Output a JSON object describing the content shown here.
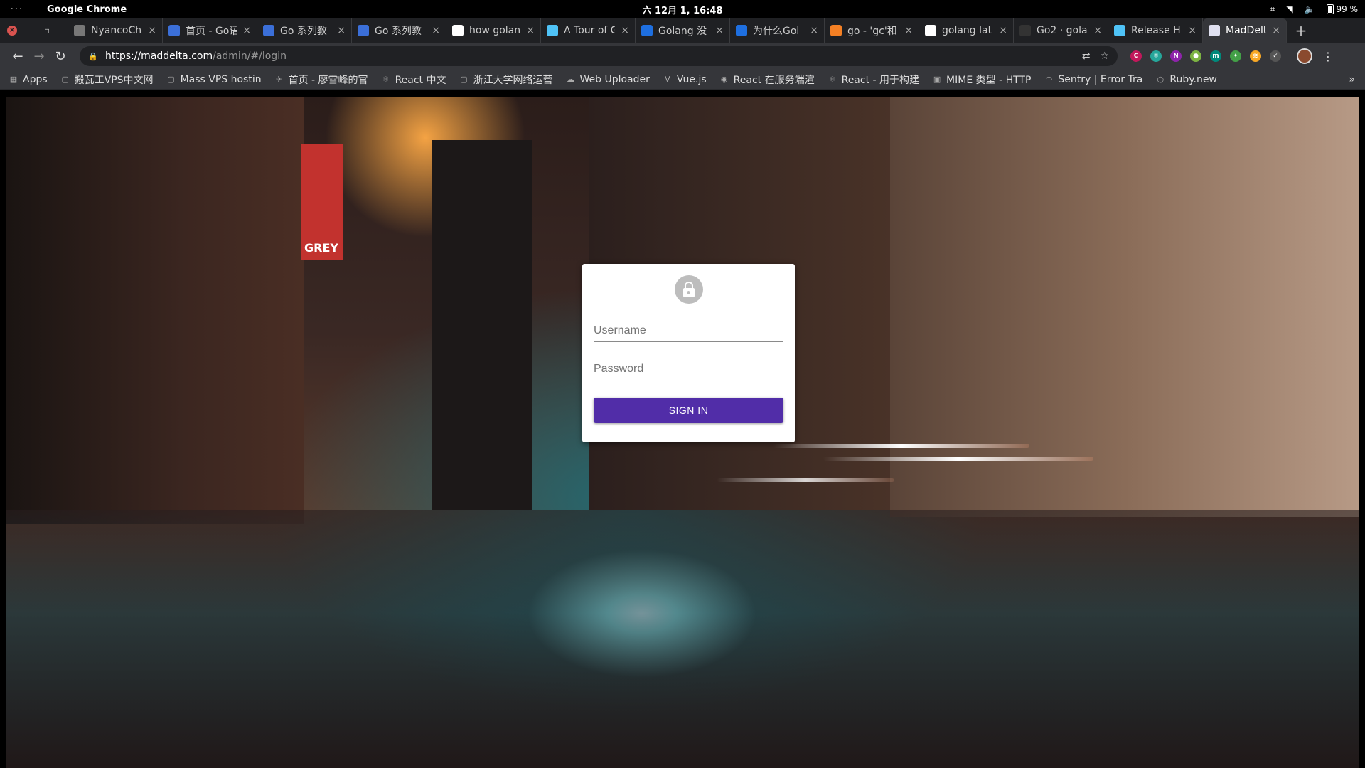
{
  "topbar": {
    "activities": "···",
    "app_name": "Google Chrome",
    "clock": "六 12月  1, 16:48",
    "battery": "99 %"
  },
  "tabs": [
    {
      "title": "NyancoCh",
      "favicon": "page-icon",
      "color": "#777"
    },
    {
      "title": "首页 - Go语",
      "favicon": "go-icon",
      "color": "#3b6fd8"
    },
    {
      "title": "Go 系列教",
      "favicon": "go-icon",
      "color": "#3b6fd8"
    },
    {
      "title": "Go 系列教",
      "favicon": "go-icon",
      "color": "#3b6fd8"
    },
    {
      "title": "how golan",
      "favicon": "google-icon",
      "color": "#ffffff"
    },
    {
      "title": "A Tour of G",
      "favicon": "doc-icon",
      "color": "#4fc3f7"
    },
    {
      "title": "Golang 没",
      "favicon": "zhihu-icon",
      "color": "#1e6fe0"
    },
    {
      "title": "为什么Gol",
      "favicon": "zhihu-icon",
      "color": "#1e6fe0"
    },
    {
      "title": "go - 'gc'和",
      "favicon": "stackoverflow-icon",
      "color": "#f48024"
    },
    {
      "title": "golang lat",
      "favicon": "google-icon",
      "color": "#ffffff"
    },
    {
      "title": "Go2 · gola",
      "favicon": "github-icon",
      "color": "#333"
    },
    {
      "title": "Release H",
      "favicon": "doc-icon",
      "color": "#4fc3f7"
    },
    {
      "title": "MadDelta",
      "favicon": "maddelta-icon",
      "color": "#e0e0f0",
      "active": true
    }
  ],
  "toolbar": {
    "url_host": "https://maddelta.com",
    "url_path": "/admin/#/login"
  },
  "bookmarks": [
    {
      "label": "Apps",
      "icon": "apps-grid-icon"
    },
    {
      "label": "搬瓦工VPS中文网",
      "icon": "page-icon"
    },
    {
      "label": "Mass VPS hostin",
      "icon": "page-icon"
    },
    {
      "label": "首页 - 廖雪峰的官",
      "icon": "bird-icon"
    },
    {
      "label": "React 中文",
      "icon": "react-icon"
    },
    {
      "label": "浙江大学网络运营",
      "icon": "page-icon"
    },
    {
      "label": "Web Uploader",
      "icon": "cloud-icon"
    },
    {
      "label": "Vue.js",
      "icon": "vue-icon"
    },
    {
      "label": "React 在服务端渲",
      "icon": "circle-icon"
    },
    {
      "label": "React - 用于构建",
      "icon": "react-icon"
    },
    {
      "label": "MIME 类型 - HTTP",
      "icon": "mdn-icon"
    },
    {
      "label": "Sentry | Error Tra",
      "icon": "sentry-icon"
    },
    {
      "label": "Ruby.new",
      "icon": "ring-icon"
    }
  ],
  "login": {
    "username_placeholder": "Username",
    "password_placeholder": "Password",
    "signin_label": "SIGN IN",
    "accent": "#512da8"
  },
  "background": {
    "banner_text": "GREY"
  }
}
